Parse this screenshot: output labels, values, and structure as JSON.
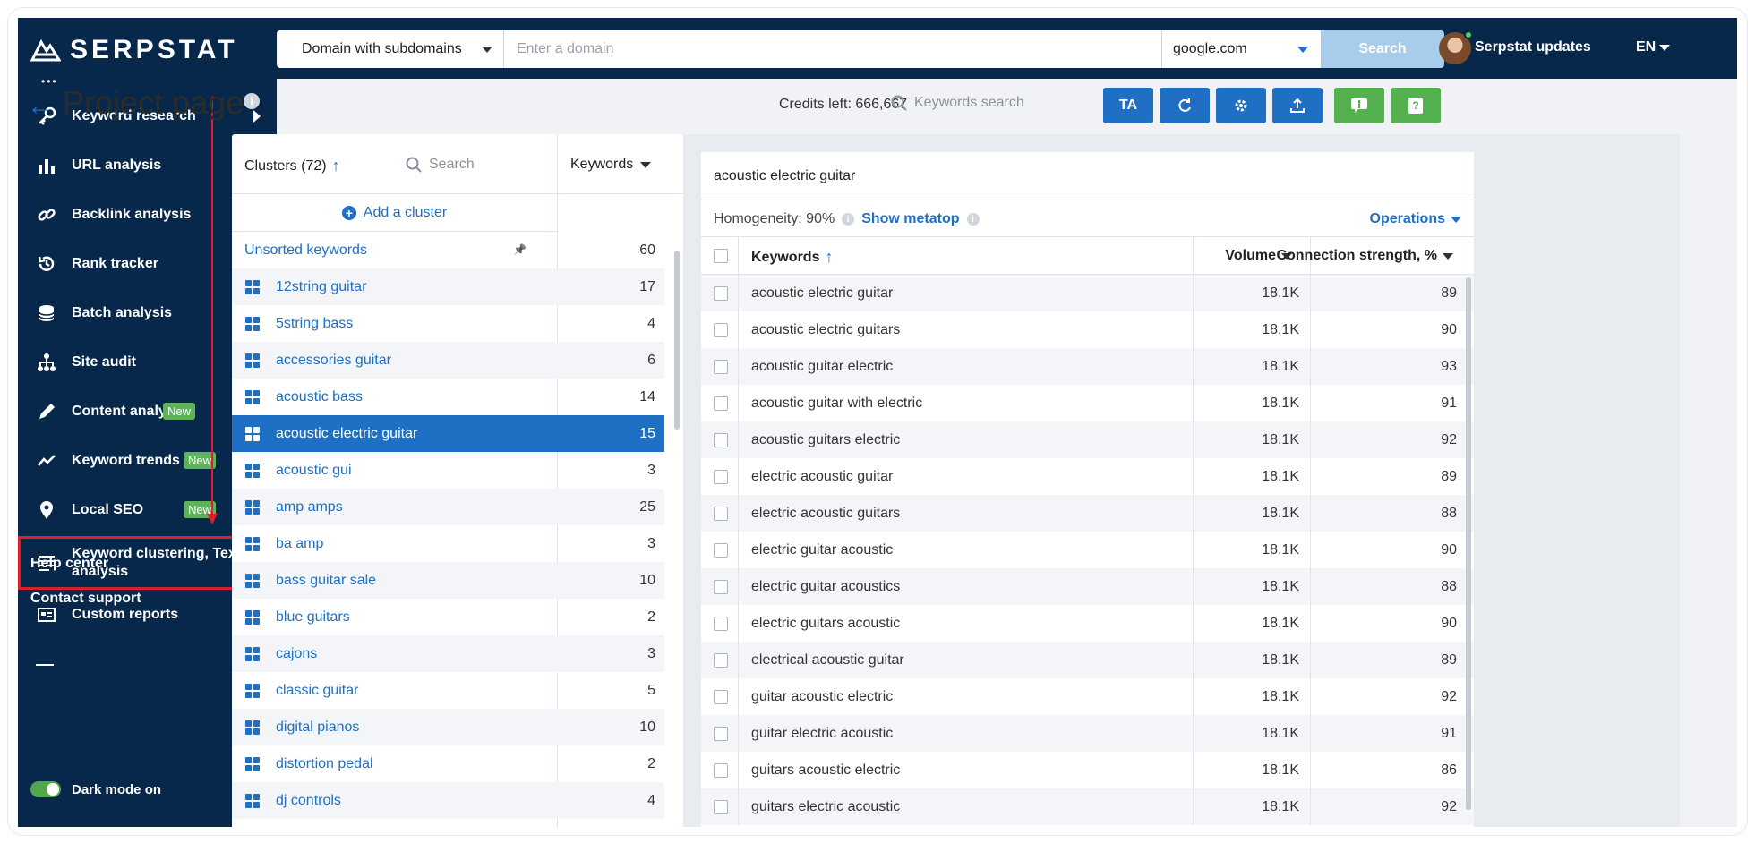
{
  "brand": {
    "name": "SERPSTAT"
  },
  "topbar": {
    "domain_mode": "Domain with subdomains",
    "domain_placeholder": "Enter a domain",
    "search_engine": "google.com",
    "search_label": "Search",
    "updates_label": "Serpstat updates",
    "lang": "EN"
  },
  "sidebar": {
    "items": [
      {
        "label": "Keyword research",
        "icon": "key-icon",
        "arrow": true,
        "badge": ""
      },
      {
        "label": "URL analysis",
        "icon": "bar-chart-icon",
        "arrow": true,
        "badge": ""
      },
      {
        "label": "Backlink analysis",
        "icon": "link-icon",
        "arrow": true,
        "badge": ""
      },
      {
        "label": "Rank tracker",
        "icon": "history-icon",
        "arrow": true,
        "badge": ""
      },
      {
        "label": "Batch analysis",
        "icon": "database-icon",
        "arrow": true,
        "badge": ""
      },
      {
        "label": "Site audit",
        "icon": "sitemap-icon",
        "arrow": true,
        "badge": ""
      },
      {
        "label": "Content analysis",
        "icon": "pen-icon",
        "arrow": true,
        "badge": "New"
      },
      {
        "label": "Keyword trends",
        "icon": "trend-icon",
        "arrow": false,
        "badge": "New"
      },
      {
        "label": "Local SEO",
        "icon": "map-pin-icon",
        "arrow": false,
        "badge": "New"
      },
      {
        "label": "Keyword clustering, Text analysis",
        "icon": "clustering-icon",
        "arrow": false,
        "badge": ""
      },
      {
        "label": "Custom reports",
        "icon": "report-icon",
        "arrow": false,
        "badge": ""
      }
    ],
    "help_center": "Help center",
    "contact_support": "Contact support",
    "dark_mode": "Dark mode on"
  },
  "page": {
    "title": "Project page",
    "credits": "Credits left: 666,667",
    "keywords_search_placeholder": "Keywords search",
    "tools": [
      "TA"
    ]
  },
  "clusters": {
    "header_label": "Clusters (72)",
    "search_placeholder": "Search",
    "keywords_col": "Keywords",
    "add_cluster": "Add a cluster",
    "rows": [
      {
        "name": "Unsorted keywords",
        "count": "60",
        "type": "unsorted"
      },
      {
        "name": "12string guitar",
        "count": "17"
      },
      {
        "name": "5string bass",
        "count": "4"
      },
      {
        "name": "accessories guitar",
        "count": "6"
      },
      {
        "name": "acoustic bass",
        "count": "14"
      },
      {
        "name": "acoustic electric guitar",
        "count": "15",
        "selected": true
      },
      {
        "name": "acoustic gui",
        "count": "3"
      },
      {
        "name": "amp amps",
        "count": "25"
      },
      {
        "name": "ba amp",
        "count": "3"
      },
      {
        "name": "bass guitar sale",
        "count": "10"
      },
      {
        "name": "blue guitars",
        "count": "2"
      },
      {
        "name": "cajons",
        "count": "3"
      },
      {
        "name": "classic guitar",
        "count": "5"
      },
      {
        "name": "digital pianos",
        "count": "10"
      },
      {
        "name": "distortion pedal",
        "count": "2"
      },
      {
        "name": "dj controls",
        "count": "4"
      }
    ]
  },
  "detail": {
    "title": "acoustic electric guitar",
    "homogeneity": "Homogeneity: 90%",
    "show_metatop": "Show metatop",
    "operations": "Operations",
    "columns": {
      "keywords": "Keywords",
      "volume": "Volume",
      "strength": "Connection strength, %"
    },
    "rows": [
      {
        "kw": "acoustic electric guitar",
        "vol": "18.1K",
        "str": "89"
      },
      {
        "kw": "acoustic electric guitars",
        "vol": "18.1K",
        "str": "90"
      },
      {
        "kw": "acoustic guitar electric",
        "vol": "18.1K",
        "str": "93"
      },
      {
        "kw": "acoustic guitar with electric",
        "vol": "18.1K",
        "str": "91"
      },
      {
        "kw": "acoustic guitars electric",
        "vol": "18.1K",
        "str": "92"
      },
      {
        "kw": "electric acoustic guitar",
        "vol": "18.1K",
        "str": "89"
      },
      {
        "kw": "electric acoustic guitars",
        "vol": "18.1K",
        "str": "88"
      },
      {
        "kw": "electric guitar acoustic",
        "vol": "18.1K",
        "str": "90"
      },
      {
        "kw": "electric guitar acoustics",
        "vol": "18.1K",
        "str": "88"
      },
      {
        "kw": "electric guitars acoustic",
        "vol": "18.1K",
        "str": "90"
      },
      {
        "kw": "electrical acoustic guitar",
        "vol": "18.1K",
        "str": "89"
      },
      {
        "kw": "guitar acoustic electric",
        "vol": "18.1K",
        "str": "92"
      },
      {
        "kw": "guitar electric acoustic",
        "vol": "18.1K",
        "str": "91"
      },
      {
        "kw": "guitars acoustic electric",
        "vol": "18.1K",
        "str": "86"
      },
      {
        "kw": "guitars electric acoustic",
        "vol": "18.1K",
        "str": "92"
      }
    ]
  },
  "colors": {
    "navy": "#07284a",
    "blue": "#1f6fc4",
    "green": "#55b14f",
    "red": "#d8212f"
  }
}
